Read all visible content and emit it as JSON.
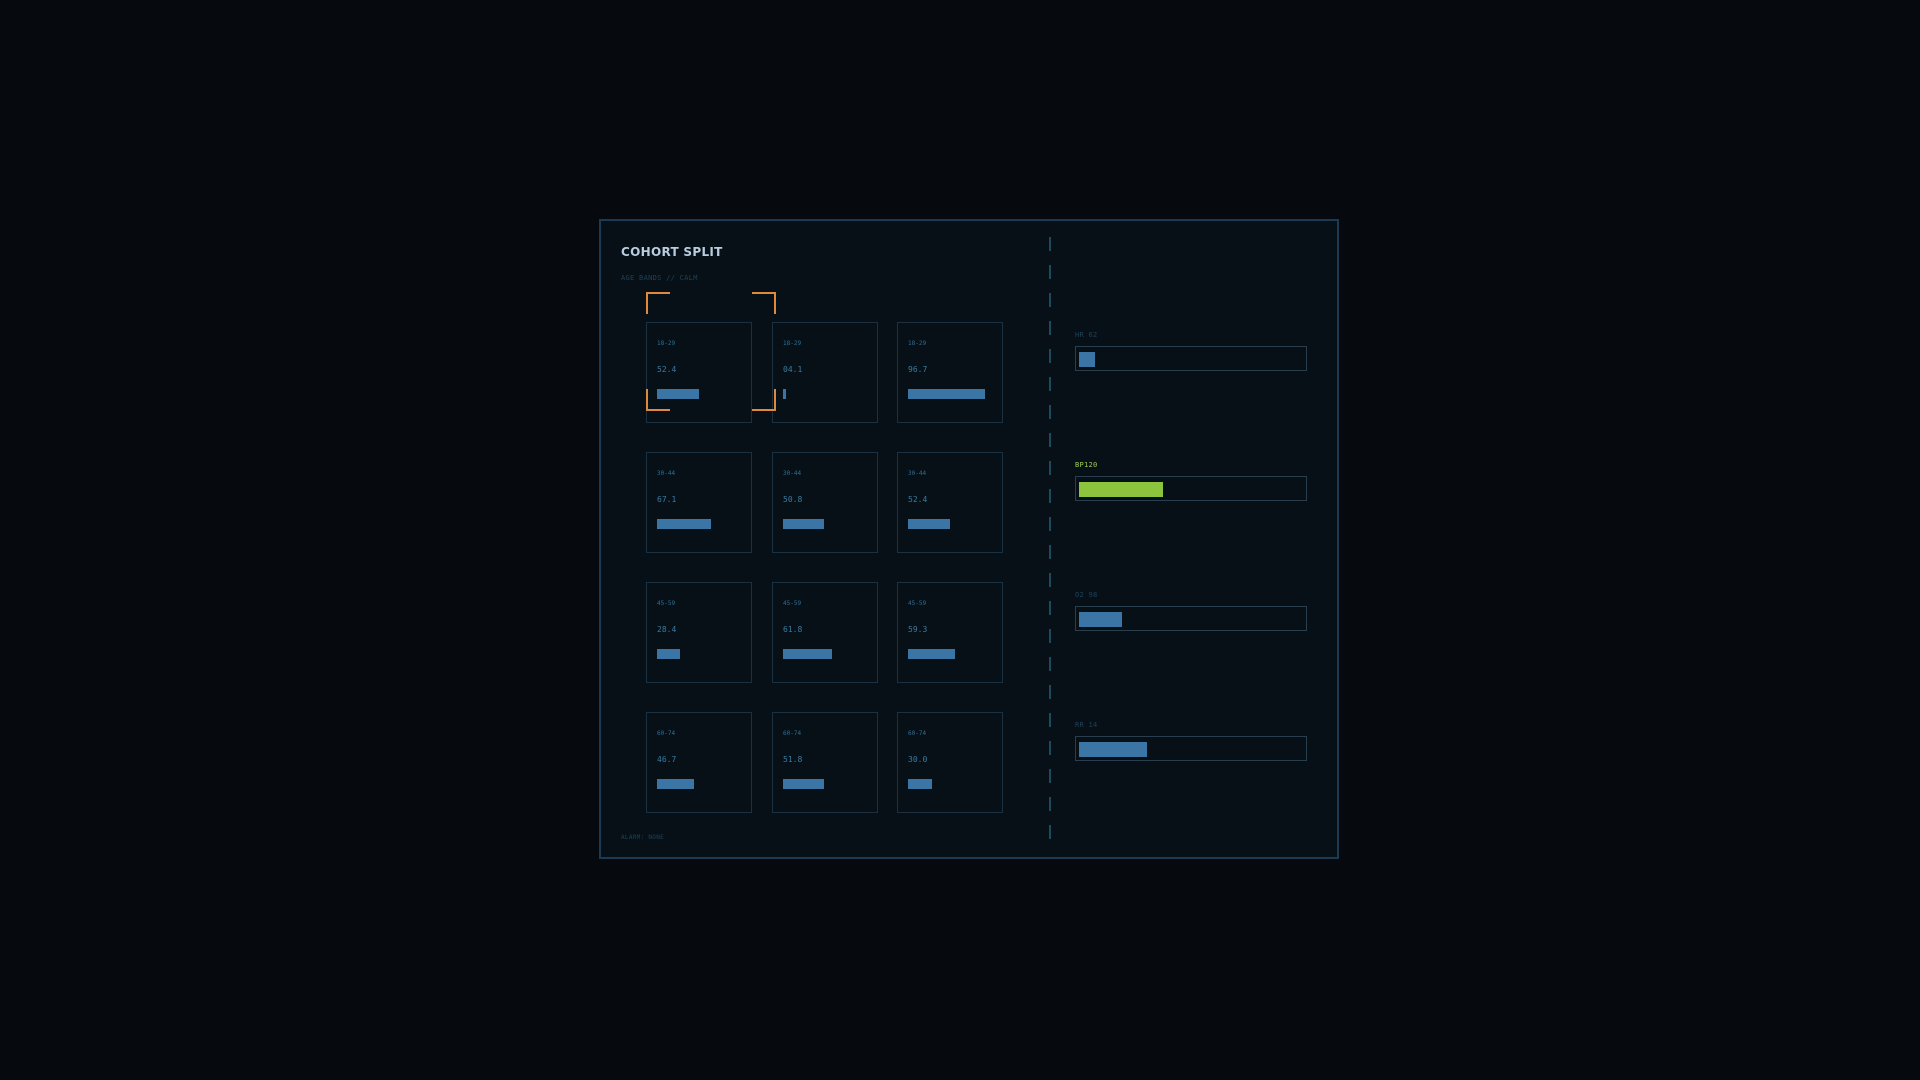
{
  "panel": {
    "title": "COHORT SPLIT",
    "subtitle": "AGE BANDS // CALM",
    "footer": "ALARM: NONE"
  },
  "colors": {
    "accent_focus": "#e0893a",
    "bar": "#3a75a6",
    "active_vital": "#8cc43d",
    "panel_border": "#1c3a52"
  },
  "grid": {
    "rows": [
      {
        "band": "18-29",
        "cells": [
          {
            "label": "18-29",
            "value": "52.4",
            "level": 0.524
          },
          {
            "label": "18-29",
            "value": "04.1",
            "level": 0.041
          },
          {
            "label": "18-29",
            "value": "96.7",
            "level": 0.967
          }
        ]
      },
      {
        "band": "30-44",
        "cells": [
          {
            "label": "30-44",
            "value": "67.1",
            "level": 0.671
          },
          {
            "label": "30-44",
            "value": "50.8",
            "level": 0.508
          },
          {
            "label": "30-44",
            "value": "52.4",
            "level": 0.524
          }
        ]
      },
      {
        "band": "45-59",
        "cells": [
          {
            "label": "45-59",
            "value": "28.4",
            "level": 0.284
          },
          {
            "label": "45-59",
            "value": "61.8",
            "level": 0.618
          },
          {
            "label": "45-59",
            "value": "59.3",
            "level": 0.593
          }
        ]
      },
      {
        "band": "60-74",
        "cells": [
          {
            "label": "60-74",
            "value": "46.7",
            "level": 0.467
          },
          {
            "label": "60-74",
            "value": "51.8",
            "level": 0.518
          },
          {
            "label": "60-74",
            "value": "30.0",
            "level": 0.3
          }
        ]
      }
    ],
    "focused": {
      "row": 0,
      "col": 0
    }
  },
  "vitals": [
    {
      "label": "HR 62",
      "level": 0.07,
      "active": false
    },
    {
      "label": "BP120",
      "level": 0.37,
      "active": true
    },
    {
      "label": "O2 98",
      "level": 0.19,
      "active": false
    },
    {
      "label": "RR 14",
      "level": 0.3,
      "active": false
    }
  ]
}
